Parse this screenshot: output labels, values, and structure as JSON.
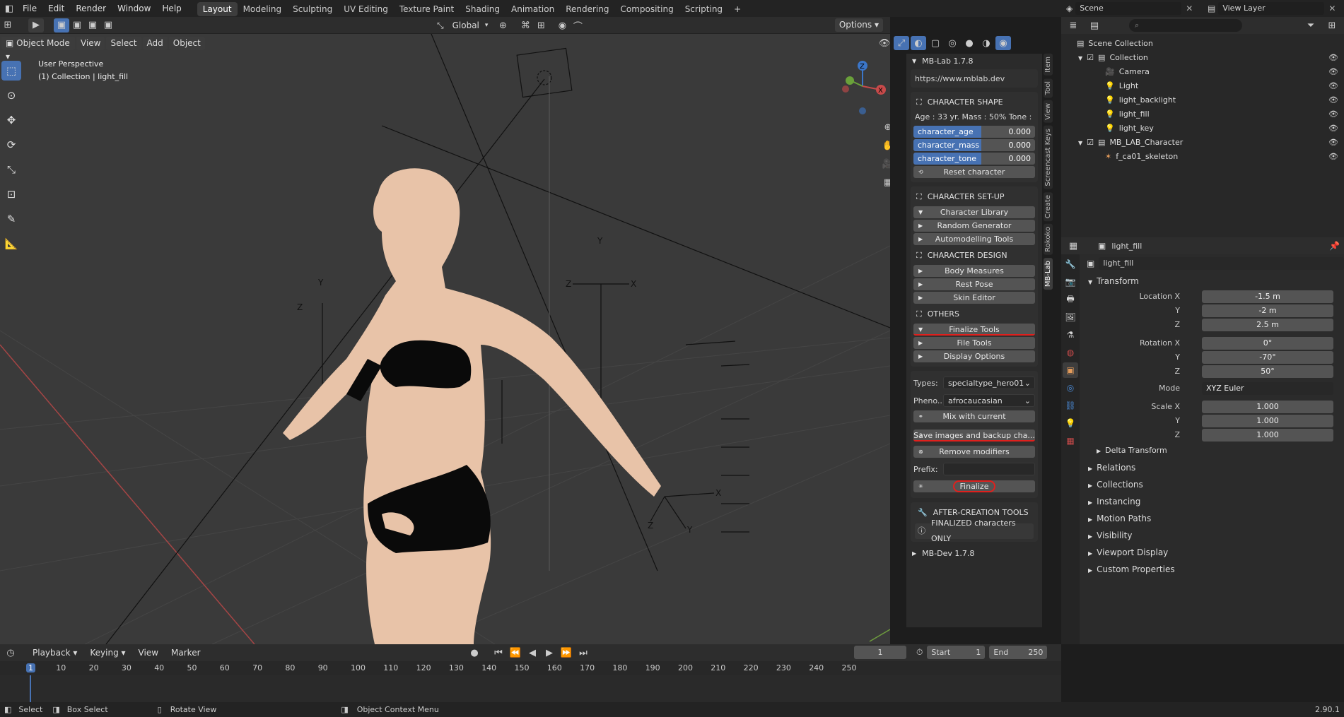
{
  "topbar": {
    "menus": [
      "File",
      "Edit",
      "Render",
      "Window",
      "Help"
    ],
    "workspaces": [
      "Layout",
      "Modeling",
      "Sculpting",
      "UV Editing",
      "Texture Paint",
      "Shading",
      "Animation",
      "Rendering",
      "Compositing",
      "Scripting"
    ],
    "active_workspace": "Layout",
    "scene": "Scene",
    "view_layer": "View Layer"
  },
  "viewport_header": {
    "transform_orientation": "Global",
    "options_label": "Options",
    "mode": "Object Mode",
    "menus": [
      "View",
      "Select",
      "Add",
      "Object"
    ]
  },
  "viewport": {
    "view_name": "User Perspective",
    "view_context": "(1) Collection | light_fill"
  },
  "npanel": {
    "title": "MB-Lab 1.7.8",
    "url": "https://www.mblab.dev",
    "character_shape": {
      "header": "CHARACTER SHAPE",
      "info": "Age : 33 yr.  Mass : 50%  Tone : ...",
      "sliders": [
        {
          "label": "character_age",
          "value": "0.000"
        },
        {
          "label": "character_mass",
          "value": "0.000"
        },
        {
          "label": "character_tone",
          "value": "0.000"
        }
      ],
      "reset": "Reset character"
    },
    "setup": {
      "header": "CHARACTER SET-UP",
      "items": [
        "Character Library",
        "Random Generator",
        "Automodelling Tools"
      ]
    },
    "design": {
      "header": "CHARACTER DESIGN",
      "items": [
        "Body Measures",
        "Rest Pose",
        "Skin Editor"
      ]
    },
    "others": {
      "header": "OTHERS",
      "items": [
        "Finalize Tools",
        "File Tools",
        "Display Options"
      ]
    },
    "types_label": "Types:",
    "types_value": "specialtype_hero01",
    "pheno_label": "Pheno...",
    "pheno_value": "afrocaucasian",
    "mix": "Mix with current",
    "save": "Save images and backup cha...",
    "remove": "Remove modifiers",
    "prefix_label": "Prefix:",
    "prefix_value": "",
    "finalize": "Finalize",
    "after_creation": "AFTER-CREATION TOOLS",
    "finalized_only": "FINALIZED characters ONLY",
    "mbdev": "MB-Dev 1.7.8"
  },
  "side_tabs": [
    "Item",
    "Tool",
    "View",
    "Screencast Keys",
    "Create",
    "Rokoko",
    "MB-Lab"
  ],
  "outliner": {
    "root": "Scene Collection",
    "rows": [
      {
        "label": "Collection",
        "indent": 1
      },
      {
        "label": "Camera",
        "indent": 2
      },
      {
        "label": "Light",
        "indent": 2
      },
      {
        "label": "light_backlight",
        "indent": 2
      },
      {
        "label": "light_fill",
        "indent": 2
      },
      {
        "label": "light_key",
        "indent": 2
      },
      {
        "label": "MB_LAB_Character",
        "indent": 1
      },
      {
        "label": "f_ca01_skeleton",
        "indent": 2
      }
    ]
  },
  "properties": {
    "object_name": "light_fill",
    "object_field": "light_fill",
    "transform_header": "Transform",
    "location": [
      {
        "label": "Location X",
        "value": "-1.5 m"
      },
      {
        "label": "Y",
        "value": "-2 m"
      },
      {
        "label": "Z",
        "value": "2.5 m"
      }
    ],
    "rotation": [
      {
        "label": "Rotation X",
        "value": "0°"
      },
      {
        "label": "Y",
        "value": "-70°"
      },
      {
        "label": "Z",
        "value": "50°"
      }
    ],
    "mode_label": "Mode",
    "mode_value": "XYZ Euler",
    "scale": [
      {
        "label": "Scale X",
        "value": "1.000"
      },
      {
        "label": "Y",
        "value": "1.000"
      },
      {
        "label": "Z",
        "value": "1.000"
      }
    ],
    "delta": "Delta Transform",
    "panels": [
      "Relations",
      "Collections",
      "Instancing",
      "Motion Paths",
      "Visibility",
      "Viewport Display",
      "Custom Properties"
    ]
  },
  "timeline": {
    "menus": [
      "Playback",
      "Keying",
      "View",
      "Marker"
    ],
    "current_frame": "1",
    "start_label": "Start",
    "start": "1",
    "end_label": "End",
    "end": "250",
    "ticks": [
      "1",
      "10",
      "20",
      "30",
      "40",
      "50",
      "60",
      "70",
      "80",
      "90",
      "100",
      "110",
      "120",
      "130",
      "140",
      "150",
      "160",
      "170",
      "180",
      "190",
      "200",
      "210",
      "220",
      "230",
      "240",
      "250"
    ]
  },
  "statusbar": {
    "select": "Select",
    "box_select": "Box Select",
    "rotate_view": "Rotate View",
    "context_menu": "Object Context Menu",
    "version": "2.90.1"
  },
  "colors": {
    "accent": "#4772b3",
    "annotation_red": "#e0201d",
    "skin": "#e8c3a8"
  }
}
